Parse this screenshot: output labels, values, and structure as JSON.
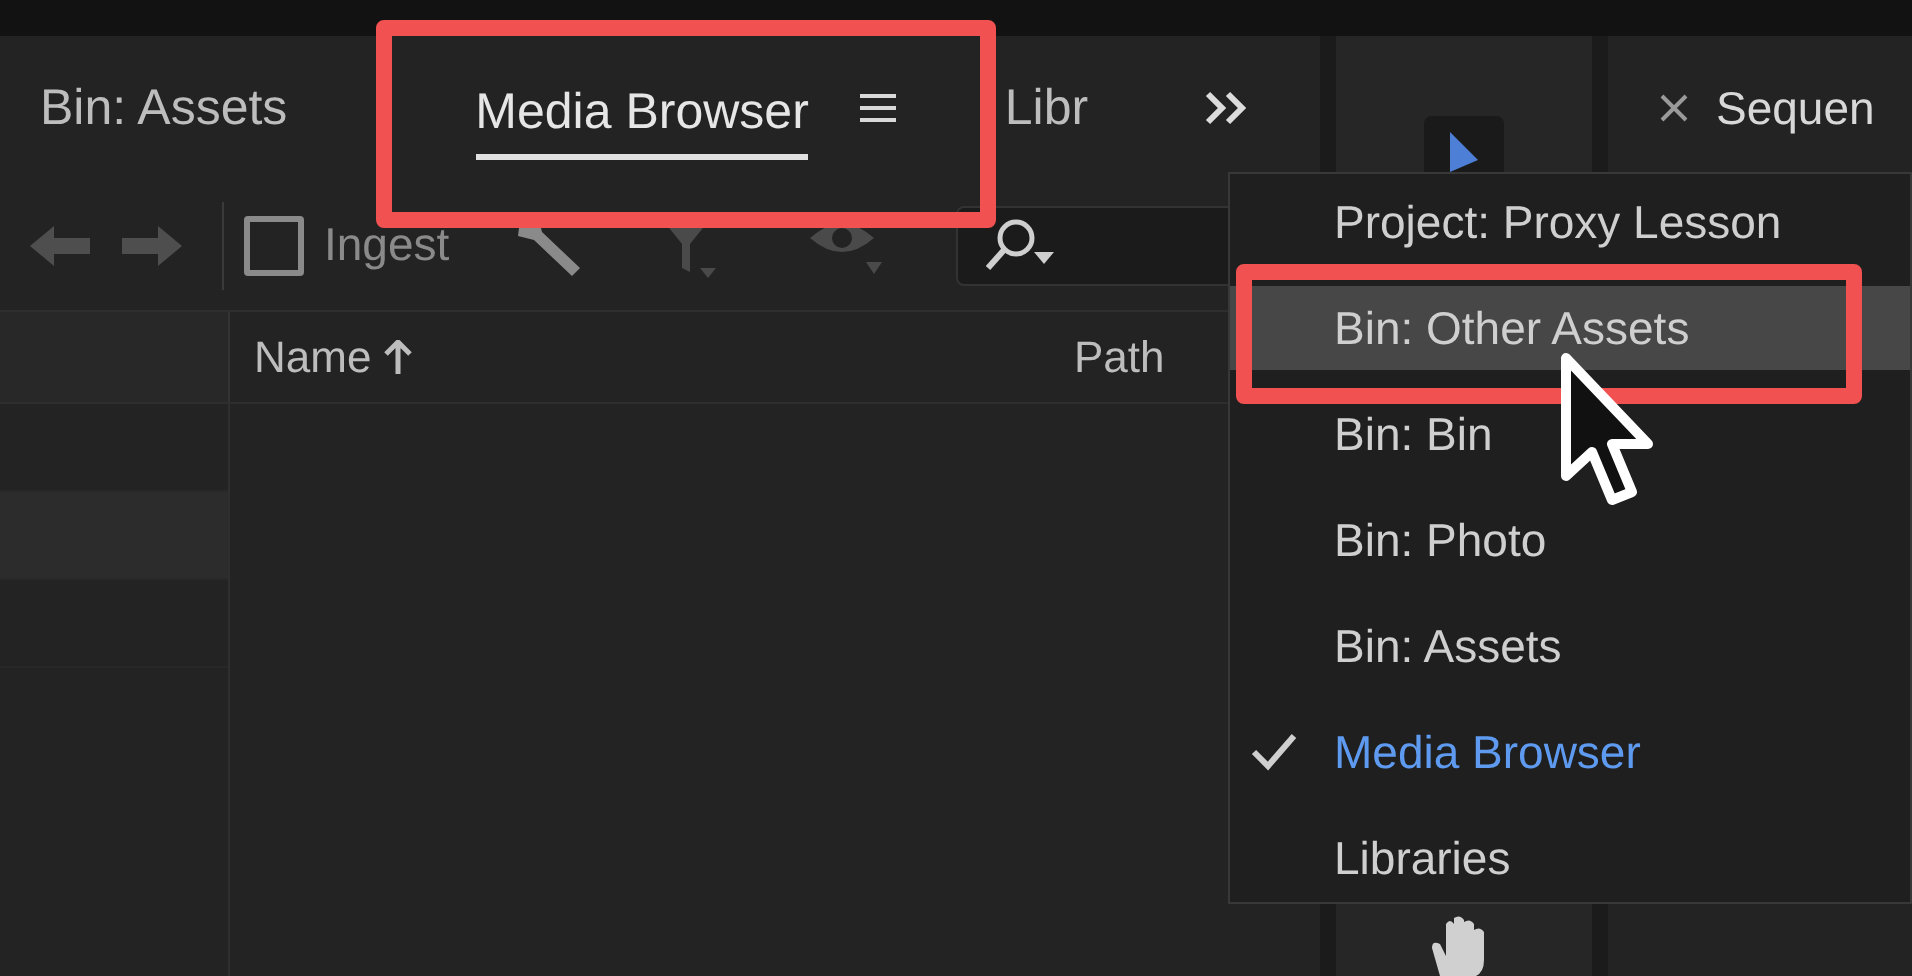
{
  "tabs": [
    {
      "label": "Bin: Assets",
      "selected": false
    },
    {
      "label": "Media Browser",
      "selected": true
    },
    {
      "label": "Libr",
      "selected": false
    }
  ],
  "toolbar": {
    "ingest": {
      "label": "Ingest",
      "checked": false
    }
  },
  "columns": [
    {
      "label": "Name",
      "sorted": true
    },
    {
      "label": "Path",
      "sorted": false
    }
  ],
  "right_panel": {
    "tab": "Sequen"
  },
  "panel_menu": {
    "items": [
      {
        "label": "Project: Proxy Lesson",
        "checked": false,
        "highlighted": false
      },
      {
        "label": "Bin: Other Assets",
        "checked": false,
        "highlighted": true
      },
      {
        "label": "Bin: Bin",
        "checked": false,
        "highlighted": false
      },
      {
        "label": "Bin: Photo",
        "checked": false,
        "highlighted": false
      },
      {
        "label": "Bin: Assets",
        "checked": false,
        "highlighted": false
      },
      {
        "label": "Media Browser",
        "checked": true,
        "highlighted": false
      },
      {
        "label": "Libraries",
        "checked": false,
        "highlighted": false
      }
    ]
  }
}
